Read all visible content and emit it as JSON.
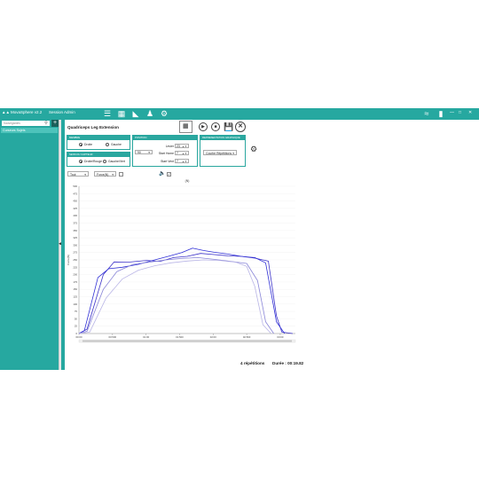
{
  "window": {
    "title": "MovaSphere v2.2",
    "user": "Session Admin",
    "controls": [
      "—",
      "□",
      "✕"
    ]
  },
  "sidebar": {
    "search_placeholder": "Sauvegardes",
    "add_label": "+",
    "items": [
      {
        "label": "Curseurs Sujets"
      }
    ]
  },
  "exercise": {
    "title": "Quadriceps Leg Extension"
  },
  "membre": {
    "header": "MEMBRE",
    "options": [
      {
        "label": "Droite",
        "selected": true
      },
      {
        "label": "Gauche",
        "selected": false
      }
    ]
  },
  "sens_capteur": {
    "header": "SENS DU CAPTEUR",
    "options": [
      {
        "label": "Droite/Rouge",
        "selected": true
      },
      {
        "label": "Gauche/Vert",
        "selected": false
      }
    ]
  },
  "position": {
    "header": "POSITION",
    "levier_label": "Levier",
    "levier_value": "23",
    "angle_value": "90",
    "start_home_label": "Start Home",
    "start_home_value": "7",
    "start_vent_label": "Start Vent",
    "start_vent_value": "7"
  },
  "representation": {
    "header": "REPRESENTATION GRAPHIQUE",
    "selected": "Courbe Répétitions"
  },
  "toolbar": {
    "play_icon": "play-icon",
    "stop_icon": "stop-icon",
    "save_icon": "save-icon",
    "close_icon": "close-icon"
  },
  "filters": {
    "time_select": "Tout",
    "unit_select": "Force(N)",
    "sound_checked": true
  },
  "chart_data": {
    "type": "line",
    "title": "(N)",
    "ylabel": "Force(N)",
    "xlabel": "",
    "ylim": [
      0,
      500
    ],
    "xlim": [
      0,
      8
    ],
    "y_ticks": [
      "0",
      "25",
      "50",
      "75",
      "100",
      "125",
      "150",
      "175",
      "200",
      "225",
      "250",
      "275",
      "300",
      "325",
      "350",
      "375",
      "400",
      "425",
      "450",
      "475",
      "500"
    ],
    "x_ticks": [
      "00:00",
      "00:500",
      "01:00",
      "01:500",
      "02:00",
      "02:500",
      "03:00"
    ],
    "series": [
      {
        "color": "#3e34c9",
        "x": [
          0,
          0.3,
          0.9,
          1.3,
          1.8,
          2.5,
          3.0,
          3.5,
          4.0,
          4.5,
          5.0,
          5.5,
          6.0,
          6.5,
          7.0,
          7.3,
          7.5,
          7.9
        ],
        "y": [
          0,
          15,
          200,
          243,
          242,
          248,
          245,
          258,
          262,
          272,
          268,
          264,
          262,
          256,
          246,
          60,
          5,
          0
        ]
      },
      {
        "color": "#2f2fd6",
        "x": [
          0,
          0.2,
          0.7,
          1.1,
          1.6,
          2.2,
          2.8,
          3.3,
          3.8,
          4.2,
          4.6,
          5.0,
          5.5,
          6.0,
          6.5,
          6.9,
          7.3,
          7.6
        ],
        "y": [
          0,
          10,
          190,
          220,
          225,
          235,
          250,
          262,
          275,
          290,
          282,
          276,
          270,
          262,
          258,
          240,
          40,
          0
        ]
      },
      {
        "color": "#8a86d8",
        "x": [
          0,
          0.3,
          0.9,
          1.4,
          2.0,
          2.6,
          3.2,
          3.8,
          4.4,
          5.0,
          5.6,
          6.2,
          6.6,
          6.9,
          7.2
        ],
        "y": [
          0,
          8,
          150,
          210,
          235,
          242,
          250,
          255,
          258,
          252,
          245,
          238,
          180,
          40,
          0
        ]
      },
      {
        "color": "#b9b5e6",
        "x": [
          0,
          0.4,
          1.0,
          1.6,
          2.2,
          2.8,
          3.4,
          4.0,
          4.6,
          5.2,
          5.8,
          6.2,
          6.5,
          6.8,
          7.1
        ],
        "y": [
          0,
          5,
          120,
          185,
          215,
          230,
          240,
          246,
          250,
          248,
          242,
          228,
          160,
          30,
          0
        ]
      }
    ]
  },
  "summary": {
    "repetitions": "4 répétitions",
    "duration": "Durée : 00:19.82"
  }
}
